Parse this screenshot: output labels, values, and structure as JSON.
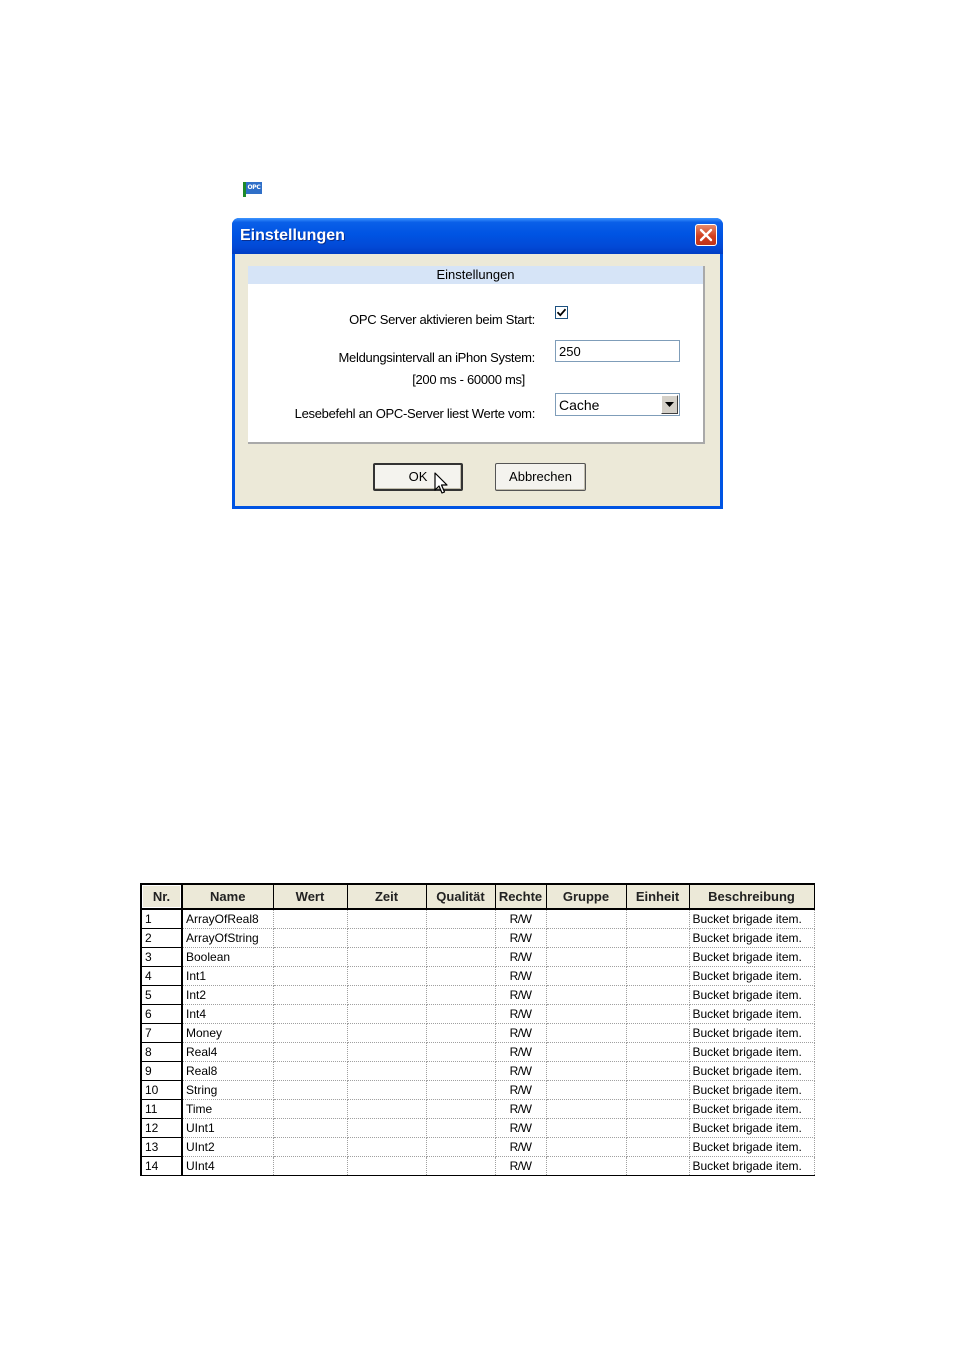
{
  "tray": {
    "icon": "opc-server-icon",
    "icon_text": "OPC"
  },
  "dialog": {
    "title": "Einstellungen",
    "section_header": "Einstellungen",
    "activate_label": "OPC Server aktivieren beim Start:",
    "activate_checked": true,
    "interval_label": "Meldungsintervall an iPhon System:",
    "interval_range": "[200 ms - 60000 ms]",
    "interval_value": "250",
    "read_label": "Lesebefehl an OPC-Server liest Werte vom:",
    "read_source": "Cache",
    "ok_label": "OK",
    "cancel_label": "Abbrechen",
    "colors": {
      "title_bar": "#0054e3",
      "close_button": "#d2401f",
      "panel_header": "#d6e4f7",
      "client": "#ece9d8"
    }
  },
  "table": {
    "columns": [
      "Nr.",
      "Name",
      "Wert",
      "Zeit",
      "Qualität",
      "Rechte",
      "Gruppe",
      "Einheit",
      "Beschreibung"
    ],
    "rows": [
      {
        "nr": "1",
        "name": "ArrayOfReal8",
        "rechte": "R/W",
        "beschreibung": "Bucket brigade item."
      },
      {
        "nr": "2",
        "name": "ArrayOfString",
        "rechte": "R/W",
        "beschreibung": "Bucket brigade item."
      },
      {
        "nr": "3",
        "name": "Boolean",
        "rechte": "R/W",
        "beschreibung": "Bucket brigade item."
      },
      {
        "nr": "4",
        "name": "Int1",
        "rechte": "R/W",
        "beschreibung": "Bucket brigade item."
      },
      {
        "nr": "5",
        "name": "Int2",
        "rechte": "R/W",
        "beschreibung": "Bucket brigade item."
      },
      {
        "nr": "6",
        "name": "Int4",
        "rechte": "R/W",
        "beschreibung": "Bucket brigade item."
      },
      {
        "nr": "7",
        "name": "Money",
        "rechte": "R/W",
        "beschreibung": "Bucket brigade item."
      },
      {
        "nr": "8",
        "name": "Real4",
        "rechte": "R/W",
        "beschreibung": "Bucket brigade item."
      },
      {
        "nr": "9",
        "name": "Real8",
        "rechte": "R/W",
        "beschreibung": "Bucket brigade item."
      },
      {
        "nr": "10",
        "name": "String",
        "rechte": "R/W",
        "beschreibung": "Bucket brigade item."
      },
      {
        "nr": "11",
        "name": "Time",
        "rechte": "R/W",
        "beschreibung": "Bucket brigade item."
      },
      {
        "nr": "12",
        "name": "UInt1",
        "rechte": "R/W",
        "beschreibung": "Bucket brigade item."
      },
      {
        "nr": "13",
        "name": "UInt2",
        "rechte": "R/W",
        "beschreibung": "Bucket brigade item."
      },
      {
        "nr": "14",
        "name": "UInt4",
        "rechte": "R/W",
        "beschreibung": "Bucket brigade item."
      }
    ]
  }
}
